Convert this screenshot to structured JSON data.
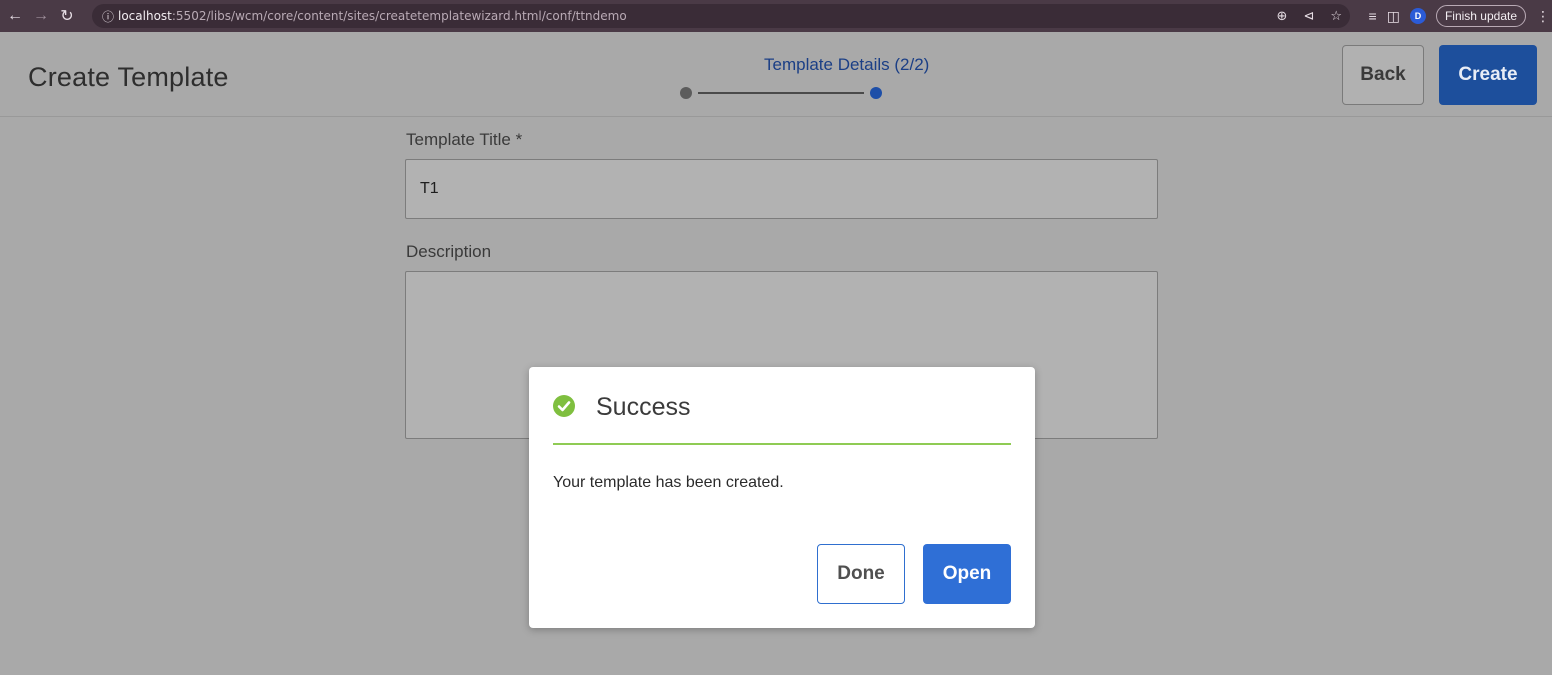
{
  "browser": {
    "back_icon": "arrow-left-icon",
    "forward_icon": "arrow-right-icon",
    "reload_icon": "reload-icon",
    "url_host": "localhost",
    "url_path": ":5502/libs/wcm/core/content/sites/createtemplatewizard.html/conf/ttndemo",
    "profile_initial": "D",
    "finish_update_label": "Finish update"
  },
  "header": {
    "title": "Create Template",
    "step_label": "Template Details (2/2)",
    "current_step": 2,
    "total_steps": 2,
    "back_label": "Back",
    "create_label": "Create"
  },
  "form": {
    "title_label": "Template Title *",
    "title_value": "T1",
    "description_label": "Description",
    "description_value": ""
  },
  "dialog": {
    "title": "Success",
    "message": "Your template has been created.",
    "done_label": "Done",
    "open_label": "Open",
    "accent_color": "#8fcb54",
    "primary_color": "#2f6fd6"
  }
}
